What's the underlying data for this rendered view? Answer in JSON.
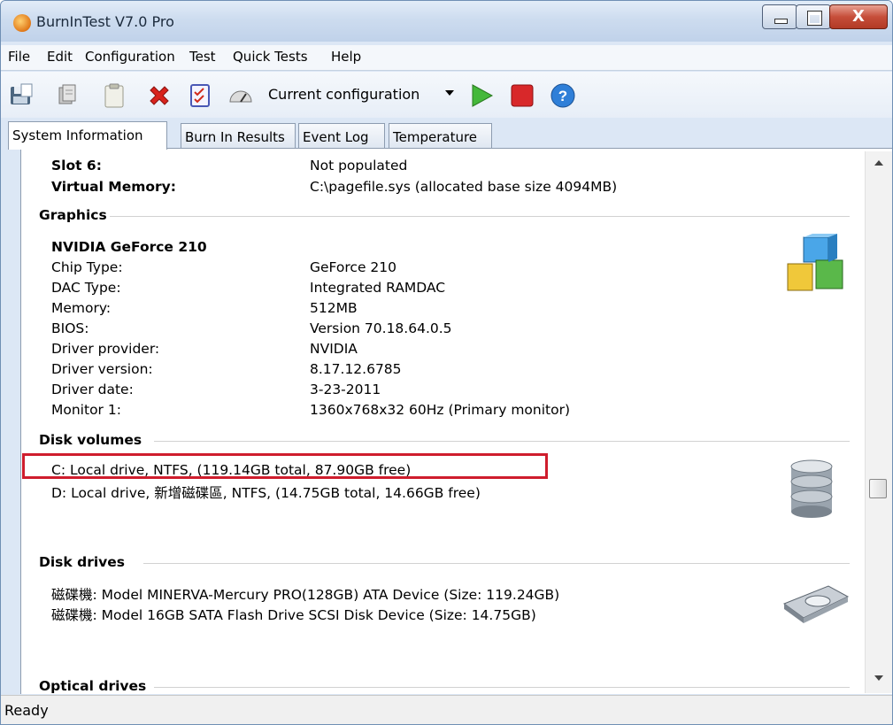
{
  "window": {
    "title": "BurnInTest V7.0 Pro",
    "close_glyph": "X"
  },
  "menu": [
    "File",
    "Edit",
    "Configuration",
    "Test",
    "Quick Tests",
    "Help"
  ],
  "toolbar": {
    "icons": [
      "save-results-icon",
      "copy-icon",
      "clipboard-icon",
      "delete-icon",
      "checklist-icon",
      "speedometer-icon",
      "play-icon",
      "stop-icon",
      "help-icon"
    ],
    "config_selected": "Current configuration"
  },
  "tabs": [
    "System Information",
    "Burn In Results",
    "Event Log",
    "Temperature"
  ],
  "memory": {
    "slot6_label": "Slot 6:",
    "slot6_value": "Not populated",
    "virtual_label": "Virtual Memory:",
    "virtual_value": "C:\\pagefile.sys (allocated base size 4094MB)"
  },
  "graphics": {
    "section_title": "Graphics",
    "device_name": "NVIDIA GeForce 210",
    "rows": [
      {
        "label": "Chip Type:",
        "value": "GeForce 210"
      },
      {
        "label": "DAC Type:",
        "value": "Integrated RAMDAC"
      },
      {
        "label": "Memory:",
        "value": "512MB"
      },
      {
        "label": "BIOS:",
        "value": "Version 70.18.64.0.5"
      },
      {
        "label": "Driver provider:",
        "value": "NVIDIA"
      },
      {
        "label": "Driver version:",
        "value": "8.17.12.6785"
      },
      {
        "label": "Driver date:",
        "value": "3-23-2011"
      },
      {
        "label": "Monitor 1:",
        "value": "1360x768x32 60Hz (Primary monitor)"
      }
    ]
  },
  "disk_volumes": {
    "section_title": "Disk volumes",
    "items": [
      "C:  Local drive, NTFS, (119.14GB total, 87.90GB free)",
      "D:  Local drive, 新增磁碟區, NTFS, (14.75GB total, 14.66GB free)"
    ]
  },
  "disk_drives": {
    "section_title": "Disk drives",
    "items": [
      "磁碟機: Model MINERVA-Mercury PRO(128GB) ATA Device (Size: 119.24GB)",
      "磁碟機: Model 16GB SATA Flash Drive SCSI Disk Device (Size: 14.75GB)"
    ]
  },
  "optical": {
    "section_title": "Optical drives"
  },
  "status": "Ready",
  "colors": {
    "highlight_box": "#cf1d2d",
    "title_bar": "#cddcef"
  }
}
